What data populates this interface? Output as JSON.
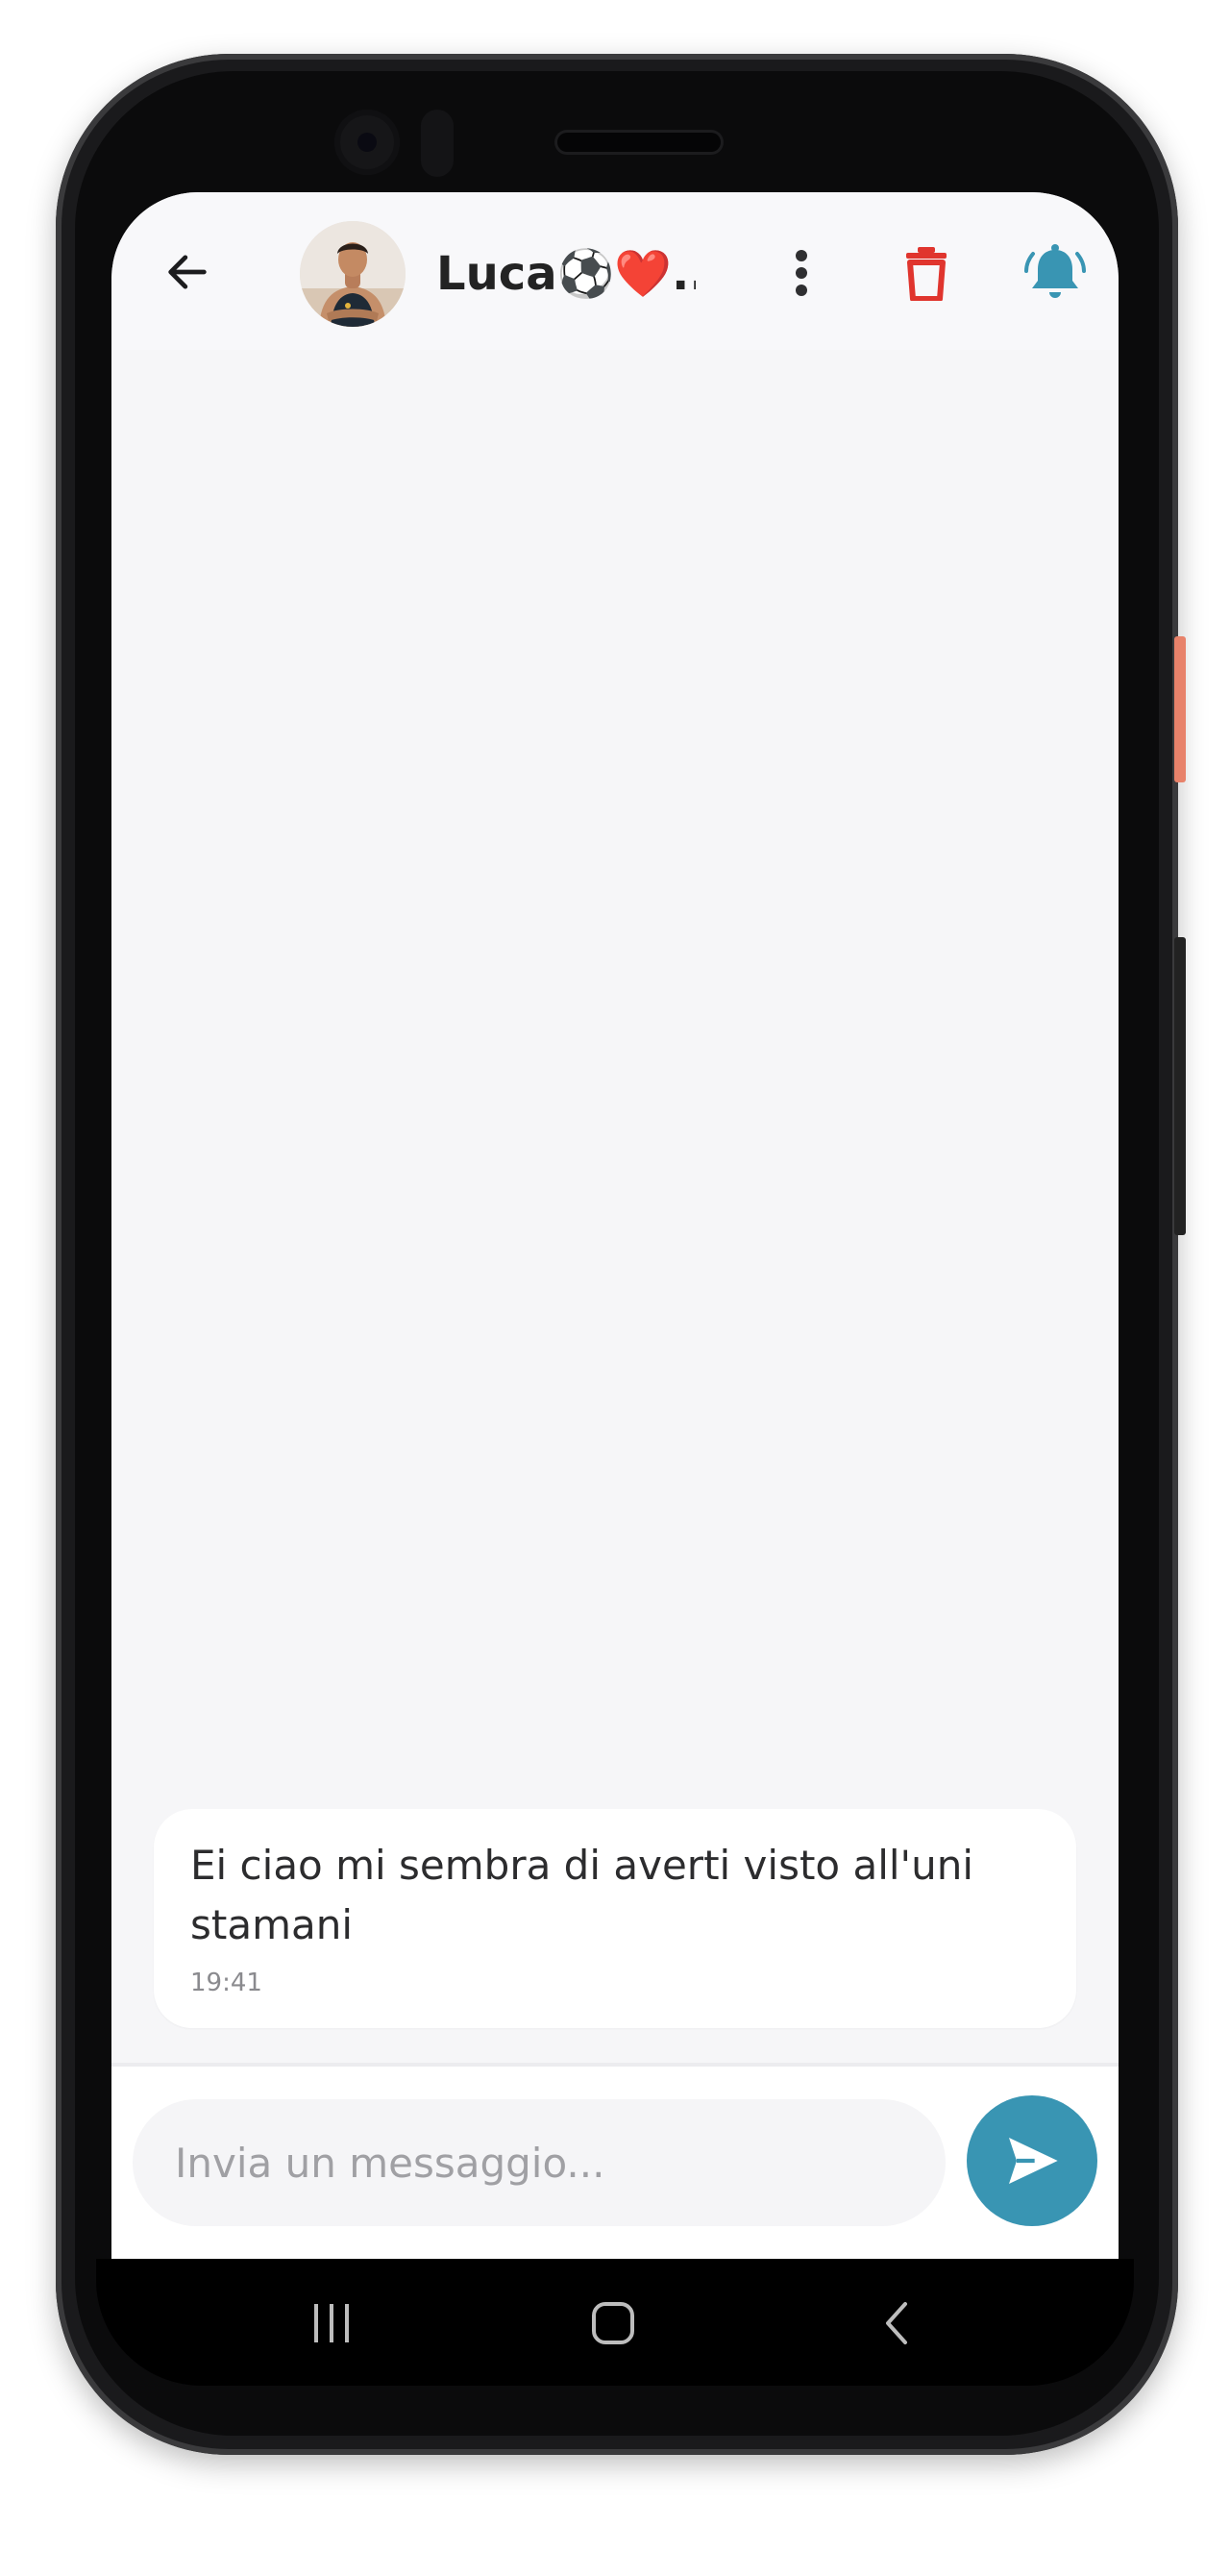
{
  "header": {
    "contact_name": "Luca⚽️❤️...",
    "back_icon": "arrow-left-icon",
    "more_icon": "more-vertical-icon",
    "delete_icon": "trash-icon",
    "notification_icon": "bell-ringing-icon"
  },
  "messages": [
    {
      "text": "Ei ciao mi sembra di averti visto all'uni stamani",
      "time": "19:41"
    }
  ],
  "composer": {
    "placeholder": "Invia un messaggio...",
    "send_icon": "send-icon"
  },
  "colors": {
    "accent": "#3995b3",
    "delete": "#e0352e",
    "background": "#f6f6f8"
  },
  "navbar": {
    "recents_icon": "recents-icon",
    "home_icon": "home-icon",
    "back_icon": "nav-back-icon"
  }
}
